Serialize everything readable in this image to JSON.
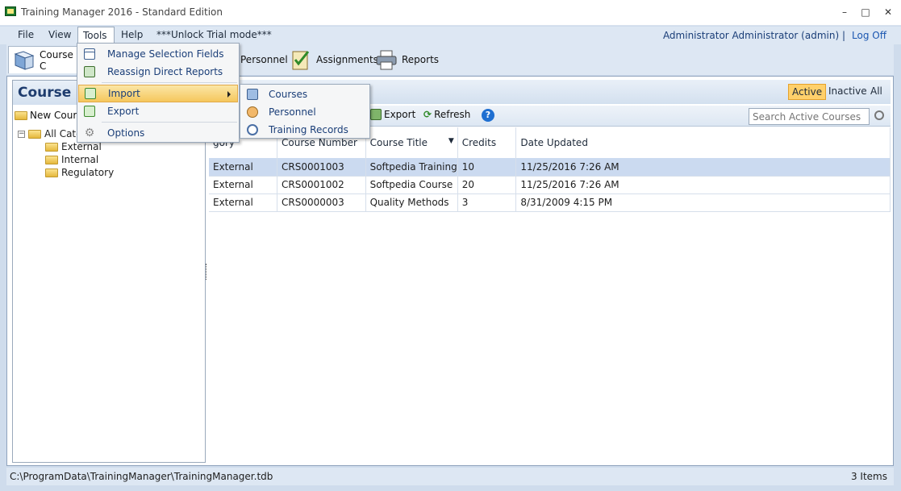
{
  "window": {
    "title": "Training Manager 2016 - Standard Edition",
    "minimize": "–",
    "maximize": "□",
    "close": "✕"
  },
  "menubar": {
    "items": [
      "File",
      "View",
      "Tools",
      "Help",
      "***Unlock Trial mode***"
    ],
    "user": "Administrator Administrator (admin)  |",
    "logoff": "Log Off"
  },
  "toolbar": {
    "tabs": [
      "Course Catalog",
      "Personnel",
      "Assignments",
      "Reports"
    ],
    "visible_course_label": "Course C"
  },
  "tools_menu": {
    "items": [
      "Manage Selection Fields",
      "Reassign Direct Reports",
      "Import",
      "Export",
      "Options"
    ],
    "import_submenu": [
      "Courses",
      "Personnel",
      "Training Records"
    ]
  },
  "left_pane": {
    "title": "Course C",
    "new_course": "New Cours",
    "tree": {
      "root": "All Cate",
      "children": [
        "External",
        "Internal",
        "Regulatory"
      ]
    }
  },
  "right_pane": {
    "filters": [
      "Active",
      "Inactive",
      "All"
    ],
    "actions": {
      "export": "Export",
      "refresh": "Refresh"
    },
    "search_placeholder": "Search Active Courses",
    "columns": [
      "gory",
      "Course Number",
      "Course Title",
      "Credits",
      "Date Updated"
    ],
    "rows": [
      [
        "External",
        "CRS0001003",
        "Softpedia Training",
        "10",
        "11/25/2016 7:26 AM"
      ],
      [
        "External",
        "CRS0001002",
        "Softpedia Course",
        "20",
        "11/25/2016 7:26 AM"
      ],
      [
        "External",
        "CRS0000003",
        "Quality Methods",
        "3",
        "8/31/2009 4:15 PM"
      ]
    ]
  },
  "statusbar": {
    "path": "C:\\ProgramData\\TrainingManager\\TrainingManager.tdb",
    "count": "3 Items"
  },
  "colors": {
    "accent": "#1a3e78",
    "selection_row": "#cbdaf0",
    "active_filter": "#ffd06b"
  }
}
